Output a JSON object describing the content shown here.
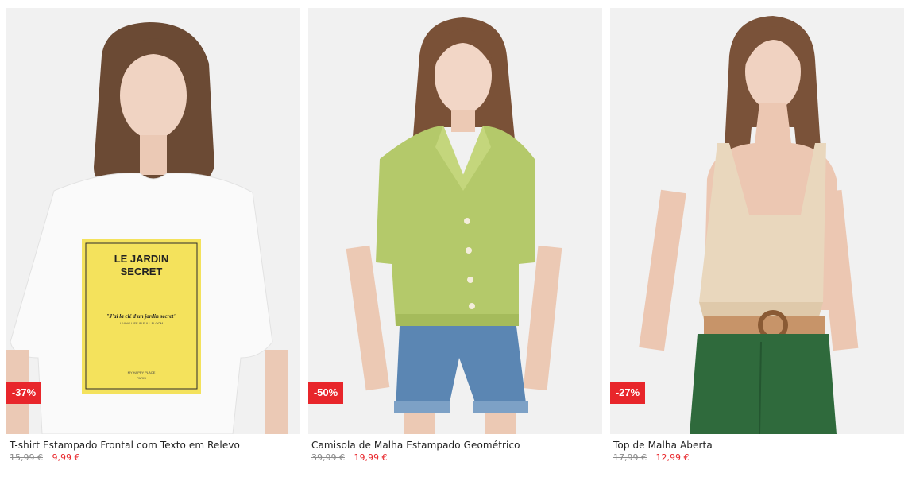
{
  "products": [
    {
      "name": "T-shirt Estampado Frontal com Texto em Relevo",
      "discount": "-37%",
      "old_price": "15,99 €",
      "new_price": "9,99 €",
      "print_title_line1": "LE JARDIN",
      "print_title_line2": "SECRET",
      "print_quote": "\"J'ai la clé d'un jardin secret\"",
      "print_sub": "LIVING LIFE IN FULL BLOOM",
      "print_footer1": "MY HAPPY PLACE",
      "print_footer2": "PARIS"
    },
    {
      "name": "Camisola de Malha Estampado Geométrico",
      "discount": "-50%",
      "old_price": "39,99 €",
      "new_price": "19,99 €"
    },
    {
      "name": "Top de Malha Aberta",
      "discount": "-27%",
      "old_price": "17,99 €",
      "new_price": "12,99 €"
    }
  ],
  "colors": {
    "badge": "#e8262b",
    "sale_price": "#e8262b",
    "old_price": "#8c8c8c",
    "photo_bg": "#efefef"
  }
}
